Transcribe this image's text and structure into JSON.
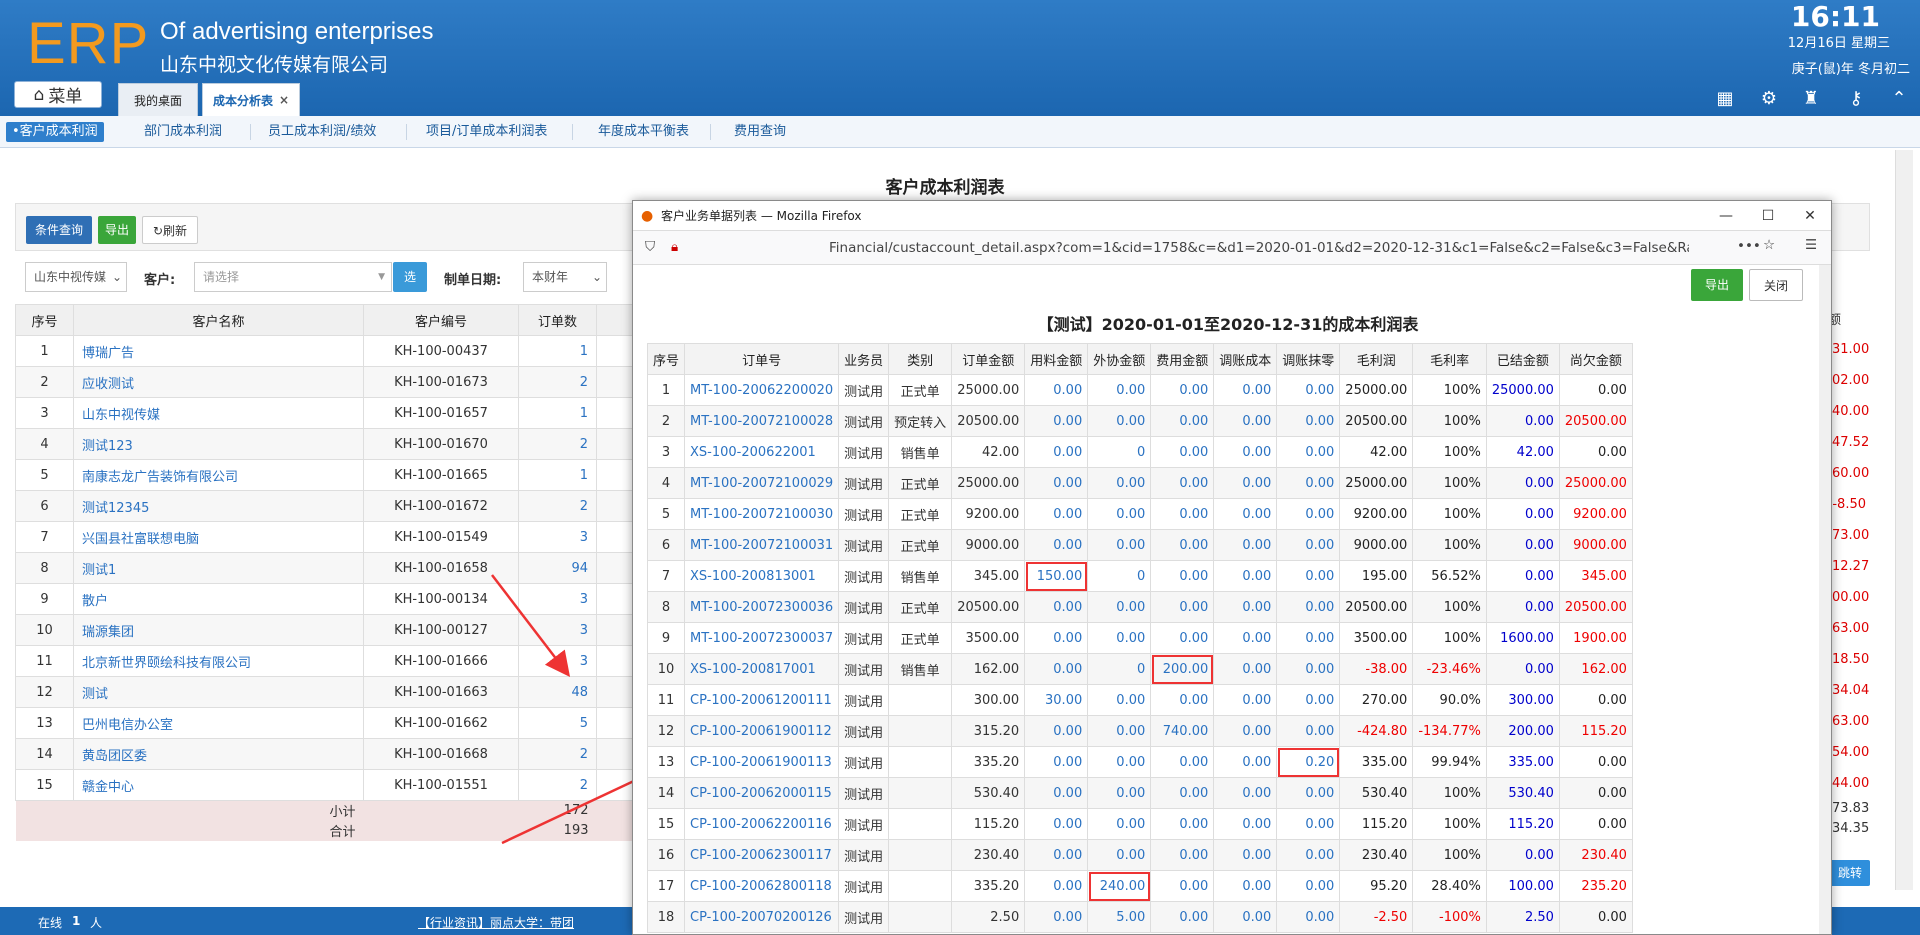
{
  "header": {
    "logo": "ERP",
    "brand_en": "Of advertising enterprises",
    "brand_cn": "山东中视文化传媒有限公司",
    "time": "16:11",
    "date": "12月16日 星期三",
    "lunar": "庚子(鼠)年 冬月初二",
    "menu_label": "菜单",
    "tabs": [
      {
        "label": "我的桌面"
      },
      {
        "label": "成本分析表"
      }
    ]
  },
  "subnav": [
    "•客户成本利润",
    "部门成本利润",
    "员工成本利润/绩效",
    "项目/订单成本利润表",
    "年度成本平衡表",
    "费用查询"
  ],
  "page": {
    "title": "客户成本利润表",
    "buttons": {
      "query": "条件查询",
      "export": "导出",
      "refresh": "刷新"
    },
    "filters": {
      "company": "山东中视传媒",
      "customer_label": "客户:",
      "customer_placeholder": "请选择",
      "select_btn": "选",
      "date_label": "制单日期:",
      "date_value": "本财年"
    }
  },
  "main_table": {
    "headers": [
      "序号",
      "客户名称",
      "客户编号",
      "订单数"
    ],
    "rows": [
      [
        "1",
        "博瑞广告",
        "KH-100-00437",
        "1"
      ],
      [
        "2",
        "应收测试",
        "KH-100-01673",
        "2"
      ],
      [
        "3",
        "山东中视传媒",
        "KH-100-01657",
        "1"
      ],
      [
        "4",
        "测试123",
        "KH-100-01670",
        "2"
      ],
      [
        "5",
        "南康志龙广告装饰有限公司",
        "KH-100-01665",
        "1"
      ],
      [
        "6",
        "测试12345",
        "KH-100-01672",
        "2"
      ],
      [
        "7",
        "兴国县社富联想电脑",
        "KH-100-01549",
        "3"
      ],
      [
        "8",
        "测试1",
        "KH-100-01658",
        "94"
      ],
      [
        "9",
        "散户",
        "KH-100-00134",
        "3"
      ],
      [
        "10",
        "瑞源集团",
        "KH-100-00127",
        "3"
      ],
      [
        "11",
        "北京新世界颐绘科技有限公司",
        "KH-100-01666",
        "3"
      ],
      [
        "12",
        "测试",
        "KH-100-01663",
        "48"
      ],
      [
        "13",
        "巴州电信办公室",
        "KH-100-01662",
        "5"
      ],
      [
        "14",
        "黄岛团区委",
        "KH-100-01668",
        "2"
      ],
      [
        "15",
        "赣金中心",
        "KH-100-01551",
        "2"
      ]
    ],
    "subtotal_label": "小计",
    "subtotal": "172",
    "total_label": "合计",
    "total": "193",
    "right_values": [
      "31.00",
      "02.00",
      "40.00",
      "47.52",
      "60.00",
      "-8.50",
      "73.00",
      "12.27",
      "00.00",
      "63.00",
      "18.50",
      "34.04",
      "63.00",
      "54.00",
      "44.00"
    ],
    "right_sub": "73.83",
    "right_total": "34.35",
    "right_header": "额",
    "jump_label": "跳转"
  },
  "statusbar": {
    "online_label": "在线",
    "online_count": "1",
    "online_unit": "人",
    "news": "【行业资讯】丽点大学：带团"
  },
  "popup": {
    "window_title": "客户业务单据列表 — Mozilla Firefox",
    "url": "Financial/custaccount_detail.aspx?com=1&cid=1758&c=&d1=2020-01-01&d2=2020-12-31&c1=False&c2=False&c3=False&Radstr",
    "export_btn": "导出",
    "close_btn": "关闭",
    "title": "【测试】2020-01-01至2020-12-31的成本利润表",
    "headers": [
      "序号",
      "订单号",
      "业务员",
      "类别",
      "订单金额",
      "用料金额",
      "外协金额",
      "费用金额",
      "调账成本",
      "调账抹零",
      "毛利润",
      "毛利率",
      "已结金额",
      "尚欠金额"
    ],
    "rows": [
      [
        "1",
        "MT-100-20062200020",
        "测试用",
        "正式单",
        "25000.00",
        "0.00",
        "0.00",
        "0.00",
        "0.00",
        "0.00",
        "25000.00",
        "100%",
        "25000.00",
        "0.00"
      ],
      [
        "2",
        "MT-100-20072100028",
        "测试用",
        "预定转入",
        "20500.00",
        "0.00",
        "0.00",
        "0.00",
        "0.00",
        "0.00",
        "20500.00",
        "100%",
        "0.00",
        "20500.00"
      ],
      [
        "3",
        "XS-100-200622001",
        "测试用",
        "销售单",
        "42.00",
        "0.00",
        "0",
        "0.00",
        "0.00",
        "0.00",
        "42.00",
        "100%",
        "42.00",
        "0.00"
      ],
      [
        "4",
        "MT-100-20072100029",
        "测试用",
        "正式单",
        "25000.00",
        "0.00",
        "0.00",
        "0.00",
        "0.00",
        "0.00",
        "25000.00",
        "100%",
        "0.00",
        "25000.00"
      ],
      [
        "5",
        "MT-100-20072100030",
        "测试用",
        "正式单",
        "9200.00",
        "0.00",
        "0.00",
        "0.00",
        "0.00",
        "0.00",
        "9200.00",
        "100%",
        "0.00",
        "9200.00"
      ],
      [
        "6",
        "MT-100-20072100031",
        "测试用",
        "正式单",
        "9000.00",
        "0.00",
        "0.00",
        "0.00",
        "0.00",
        "0.00",
        "9000.00",
        "100%",
        "0.00",
        "9000.00"
      ],
      [
        "7",
        "XS-100-200813001",
        "测试用",
        "销售单",
        "345.00",
        "150.00",
        "0",
        "0.00",
        "0.00",
        "0.00",
        "195.00",
        "56.52%",
        "0.00",
        "345.00"
      ],
      [
        "8",
        "MT-100-20072300036",
        "测试用",
        "正式单",
        "20500.00",
        "0.00",
        "0.00",
        "0.00",
        "0.00",
        "0.00",
        "20500.00",
        "100%",
        "0.00",
        "20500.00"
      ],
      [
        "9",
        "MT-100-20072300037",
        "测试用",
        "正式单",
        "3500.00",
        "0.00",
        "0.00",
        "0.00",
        "0.00",
        "0.00",
        "3500.00",
        "100%",
        "1600.00",
        "1900.00"
      ],
      [
        "10",
        "XS-100-200817001",
        "测试用",
        "销售单",
        "162.00",
        "0.00",
        "0",
        "200.00",
        "0.00",
        "0.00",
        "-38.00",
        "-23.46%",
        "0.00",
        "162.00"
      ],
      [
        "11",
        "CP-100-20061200111",
        "测试用",
        "",
        "300.00",
        "30.00",
        "0.00",
        "0.00",
        "0.00",
        "0.00",
        "270.00",
        "90.0%",
        "300.00",
        "0.00"
      ],
      [
        "12",
        "CP-100-20061900112",
        "测试用",
        "",
        "315.20",
        "0.00",
        "0.00",
        "740.00",
        "0.00",
        "0.00",
        "-424.80",
        "-134.77%",
        "200.00",
        "115.20"
      ],
      [
        "13",
        "CP-100-20061900113",
        "测试用",
        "",
        "335.20",
        "0.00",
        "0.00",
        "0.00",
        "0.00",
        "0.20",
        "335.00",
        "99.94%",
        "335.00",
        "0.00"
      ],
      [
        "14",
        "CP-100-20062000115",
        "测试用",
        "",
        "530.40",
        "0.00",
        "0.00",
        "0.00",
        "0.00",
        "0.00",
        "530.40",
        "100%",
        "530.40",
        "0.00"
      ],
      [
        "15",
        "CP-100-20062200116",
        "测试用",
        "",
        "115.20",
        "0.00",
        "0.00",
        "0.00",
        "0.00",
        "0.00",
        "115.20",
        "100%",
        "115.20",
        "0.00"
      ],
      [
        "16",
        "CP-100-20062300117",
        "测试用",
        "",
        "230.40",
        "0.00",
        "0.00",
        "0.00",
        "0.00",
        "0.00",
        "230.40",
        "100%",
        "0.00",
        "230.40"
      ],
      [
        "17",
        "CP-100-20062800118",
        "测试用",
        "",
        "335.20",
        "0.00",
        "240.00",
        "0.00",
        "0.00",
        "0.00",
        "95.20",
        "28.40%",
        "100.00",
        "235.20"
      ],
      [
        "18",
        "CP-100-20070200126",
        "测试用",
        "",
        "2.50",
        "0.00",
        "5.00",
        "0.00",
        "0.00",
        "0.00",
        "-2.50",
        "-100%",
        "2.50",
        "0.00"
      ]
    ],
    "highlights": [
      [
        6,
        5
      ],
      [
        9,
        7
      ],
      [
        12,
        9
      ],
      [
        16,
        6
      ]
    ]
  },
  "colors": {
    "header_bg": "#1c66b0",
    "logo": "#f39a1f",
    "link": "#2a72c2",
    "negative": "#e00000",
    "highlight_box": "#e33333",
    "export_btn": "#3aa63a",
    "query_btn": "#2f6fb5"
  },
  "annotations": {
    "arrows": "red arrows pointing from the row 12 order count to the popup window"
  }
}
